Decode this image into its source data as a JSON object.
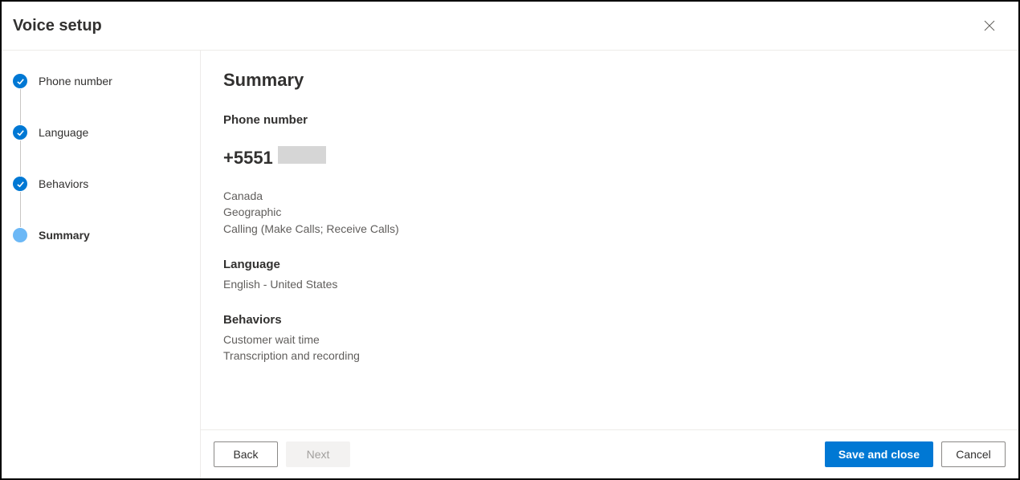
{
  "header": {
    "title": "Voice setup"
  },
  "sidebar": {
    "steps": [
      {
        "label": "Phone number",
        "state": "completed"
      },
      {
        "label": "Language",
        "state": "completed"
      },
      {
        "label": "Behaviors",
        "state": "completed"
      },
      {
        "label": "Summary",
        "state": "current"
      }
    ]
  },
  "main": {
    "title": "Summary",
    "phone_section": {
      "label": "Phone number",
      "number": "+5551",
      "country": "Canada",
      "type": "Geographic",
      "calling": "Calling (Make Calls; Receive Calls)"
    },
    "language_section": {
      "label": "Language",
      "value": "English - United States"
    },
    "behaviors_section": {
      "label": "Behaviors",
      "items": [
        "Customer wait time",
        "Transcription and recording"
      ]
    }
  },
  "footer": {
    "back": "Back",
    "next": "Next",
    "save": "Save and close",
    "cancel": "Cancel"
  }
}
